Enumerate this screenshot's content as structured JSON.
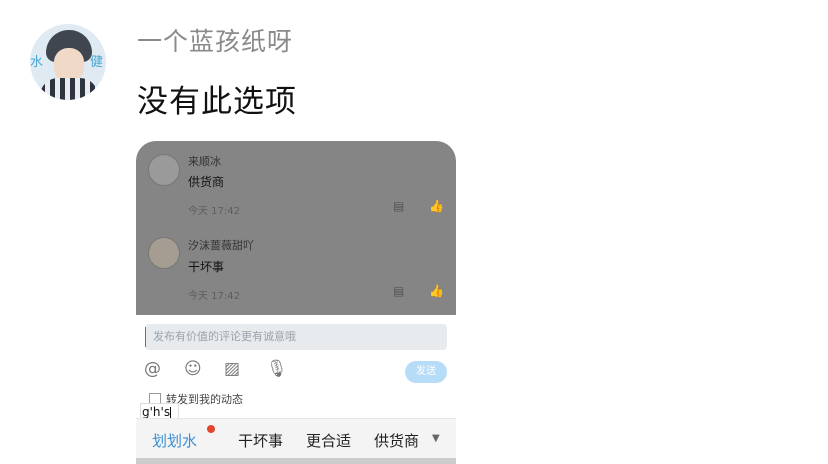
{
  "chat": {
    "sender_name": "一个蓝孩纸呀",
    "message_text": "没有此选项",
    "avatar_text_left": "水",
    "avatar_text_right": "健"
  },
  "screenshot": {
    "comments": [
      {
        "user": "来顺冰",
        "text": "供货商",
        "time": "今天 17:42"
      },
      {
        "user": "汐沫蔷薇甜吖",
        "text": "干坏事",
        "time": "今天 17:42"
      }
    ],
    "input_placeholder": "发布有价值的评论更有诚意哦",
    "send_label": "发送",
    "repost_label": "转发到我的动态",
    "ime_text": "g'h's",
    "tabs": [
      "划划水",
      "干坏事",
      "更合适",
      "供货商"
    ],
    "icons": [
      "at-icon",
      "emoji-icon",
      "image-icon",
      "mic-icon",
      "reply-icon",
      "like-icon",
      "dropdown-icon"
    ],
    "accent_color": "#3a8fd6",
    "badge_color": "#e2452d"
  }
}
